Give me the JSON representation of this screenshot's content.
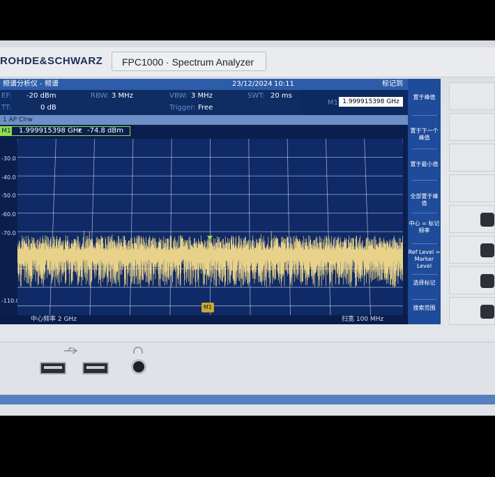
{
  "device": {
    "brand": "ROHDE&SCHWARZ",
    "model": "FPC1000 · Spectrum Analyzer"
  },
  "screen": {
    "mode_title": "频谱分析仪 - 频谱",
    "date": "23/12/2024",
    "time": "10:11",
    "marker_mode": "标记到",
    "ref_label": "EF:",
    "ref_value": "-20 dBm",
    "att_label": "TT:",
    "att_value": "0 dB",
    "rbw_label": "RBW:",
    "rbw_value": "3 MHz",
    "vbw_label": "VBW:",
    "vbw_value": "3 MHz",
    "swt_label": "SWT:",
    "swt_value": "20 ms",
    "trigger_label": "Trigger:",
    "trigger_value": "Free",
    "m1_label": "M1",
    "m1_freq": "1.999915398 GHz",
    "trace_label": "1 AP Clrw",
    "marker_tag": "M1",
    "marker_freq": "1.999915398 GHz",
    "marker_dot": "•",
    "marker_level": "-74.8 dBm",
    "marker_flag": "M1",
    "center_label": "中心频率 2 GHz",
    "span_label": "扫宽 100 MHz",
    "y_ticks": [
      "-30.0",
      "-40.0",
      "-50.0",
      "-60.0",
      "-70.0",
      "-110.0"
    ]
  },
  "softkeys": [
    {
      "label": "置于峰值"
    },
    {
      "label": "置于下一个峰值"
    },
    {
      "label": "置于最小值"
    },
    {
      "label": "全部置于峰值"
    },
    {
      "label": "中心 = 标记频率"
    },
    {
      "label": "Ref Level = Marker Level"
    },
    {
      "label": "选择标记"
    },
    {
      "label": "搜索范围"
    }
  ],
  "colors": {
    "trace": "#e8d28a",
    "grid": "#c8d6ee",
    "screen_bg": "#0f2a66",
    "softkey_bg": "#1e4b9a",
    "marker_box": "#8be04a"
  },
  "chart_data": {
    "type": "line",
    "title": "",
    "xlabel": "",
    "ylabel": "",
    "x_center_ghz": 2,
    "x_span_mhz": 100,
    "ylim": [
      -115,
      -20
    ],
    "y_ticks": [
      -30,
      -40,
      -50,
      -60,
      -70,
      -110
    ],
    "grid": true,
    "series": [
      {
        "noise_floor_dbm": -80,
        "noise_peak_dbm": -72,
        "noise_low_dbm": -95
      }
    ],
    "marker": {
      "freq_ghz": 1.999915398,
      "level_dbm": -74.8
    }
  }
}
